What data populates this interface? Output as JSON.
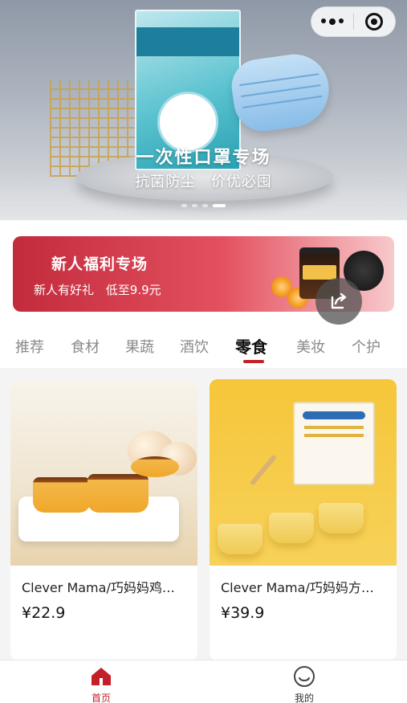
{
  "hero": {
    "title": "一次性口罩专场",
    "subtitle_left": "抗菌防尘",
    "subtitle_right": "价优必囤",
    "pages": 4,
    "active_page": 4
  },
  "capsule": {
    "more_icon": "more-dots-icon",
    "close_icon": "mini-program-close-icon"
  },
  "promo": {
    "title": "新人福利专场",
    "subtitle_left": "新人有好礼",
    "subtitle_right": "低至9.9元"
  },
  "share_icon": "share-icon",
  "tabs": [
    {
      "label": "推荐",
      "active": false
    },
    {
      "label": "食材",
      "active": false
    },
    {
      "label": "果蔬",
      "active": false
    },
    {
      "label": "酒饮",
      "active": false
    },
    {
      "label": "零食",
      "active": true
    },
    {
      "label": "美妆",
      "active": false
    },
    {
      "label": "个护",
      "active": false
    }
  ],
  "products": [
    {
      "name": "Clever Mama/巧妈妈鸡…",
      "price": "¥22.9"
    },
    {
      "name": "Clever Mama/巧妈妈方…",
      "price": "¥39.9"
    }
  ],
  "bottom_nav": [
    {
      "label": "首页",
      "icon": "home-icon",
      "active": true
    },
    {
      "label": "我的",
      "icon": "smiley-profile-icon",
      "active": false
    }
  ],
  "colors": {
    "accent": "#c4202a",
    "promo_start": "#c22b3c",
    "background": "#f4f4f4"
  }
}
